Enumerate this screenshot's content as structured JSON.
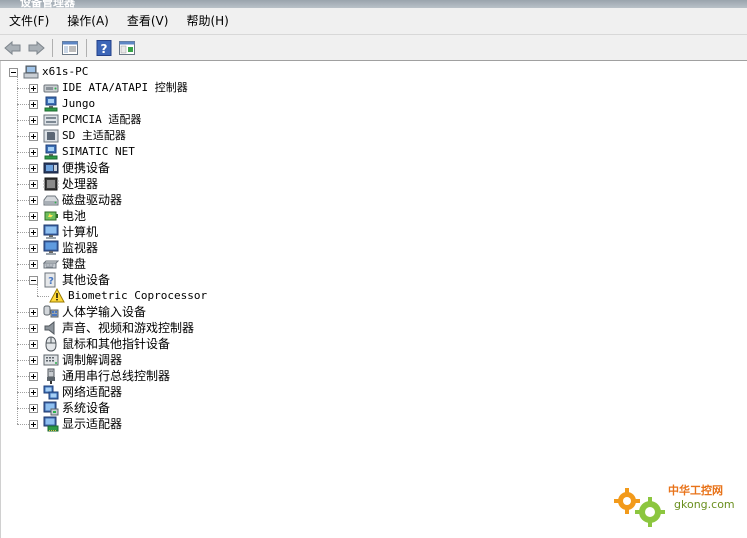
{
  "window": {
    "title": "设备管理器"
  },
  "menu": [
    "文件(F)",
    "操作(A)",
    "查看(V)",
    "帮助(H)"
  ],
  "toolbar": {
    "buttons": [
      "back-icon",
      "forward-icon",
      "show-hide-console-tree-icon",
      "help-icon",
      "properties-icon"
    ]
  },
  "tree": {
    "root": {
      "label": "x61s-PC",
      "icon": "computer-icon",
      "expanded": true
    },
    "items": [
      {
        "label": "IDE ATA/ATAPI 控制器",
        "icon": "ide-controller-icon",
        "expanded": false
      },
      {
        "label": "Jungo",
        "icon": "network-device-icon",
        "expanded": false
      },
      {
        "label": "PCMCIA 适配器",
        "icon": "pcmcia-adapter-icon",
        "expanded": false
      },
      {
        "label": "SD 主适配器",
        "icon": "sd-host-adapter-icon",
        "expanded": false
      },
      {
        "label": "SIMATIC NET",
        "icon": "network-device-icon",
        "expanded": false
      },
      {
        "label": "便携设备",
        "icon": "portable-device-icon",
        "expanded": false
      },
      {
        "label": "处理器",
        "icon": "processor-icon",
        "expanded": false
      },
      {
        "label": "磁盘驱动器",
        "icon": "disk-drive-icon",
        "expanded": false
      },
      {
        "label": "电池",
        "icon": "battery-icon",
        "expanded": false
      },
      {
        "label": "计算机",
        "icon": "computer-monitor-icon",
        "expanded": false
      },
      {
        "label": "监视器",
        "icon": "monitor-icon",
        "expanded": false
      },
      {
        "label": "键盘",
        "icon": "keyboard-icon",
        "expanded": false
      },
      {
        "label": "其他设备",
        "icon": "unknown-device-icon",
        "expanded": true,
        "children": [
          {
            "label": "Biometric Coprocessor",
            "icon": "warning-icon"
          }
        ]
      },
      {
        "label": "人体学输入设备",
        "icon": "hid-icon",
        "expanded": false
      },
      {
        "label": "声音、视频和游戏控制器",
        "icon": "speaker-icon",
        "expanded": false
      },
      {
        "label": "鼠标和其他指针设备",
        "icon": "mouse-icon",
        "expanded": false
      },
      {
        "label": "调制解调器",
        "icon": "modem-icon",
        "expanded": false
      },
      {
        "label": "通用串行总线控制器",
        "icon": "usb-icon",
        "expanded": false
      },
      {
        "label": "网络适配器",
        "icon": "network-adapter-icon",
        "expanded": false
      },
      {
        "label": "系统设备",
        "icon": "system-device-icon",
        "expanded": false
      },
      {
        "label": "显示适配器",
        "icon": "display-adapter-icon",
        "expanded": false
      }
    ]
  },
  "watermark": {
    "line1": "中华工控网",
    "line2": "gkong.com"
  }
}
